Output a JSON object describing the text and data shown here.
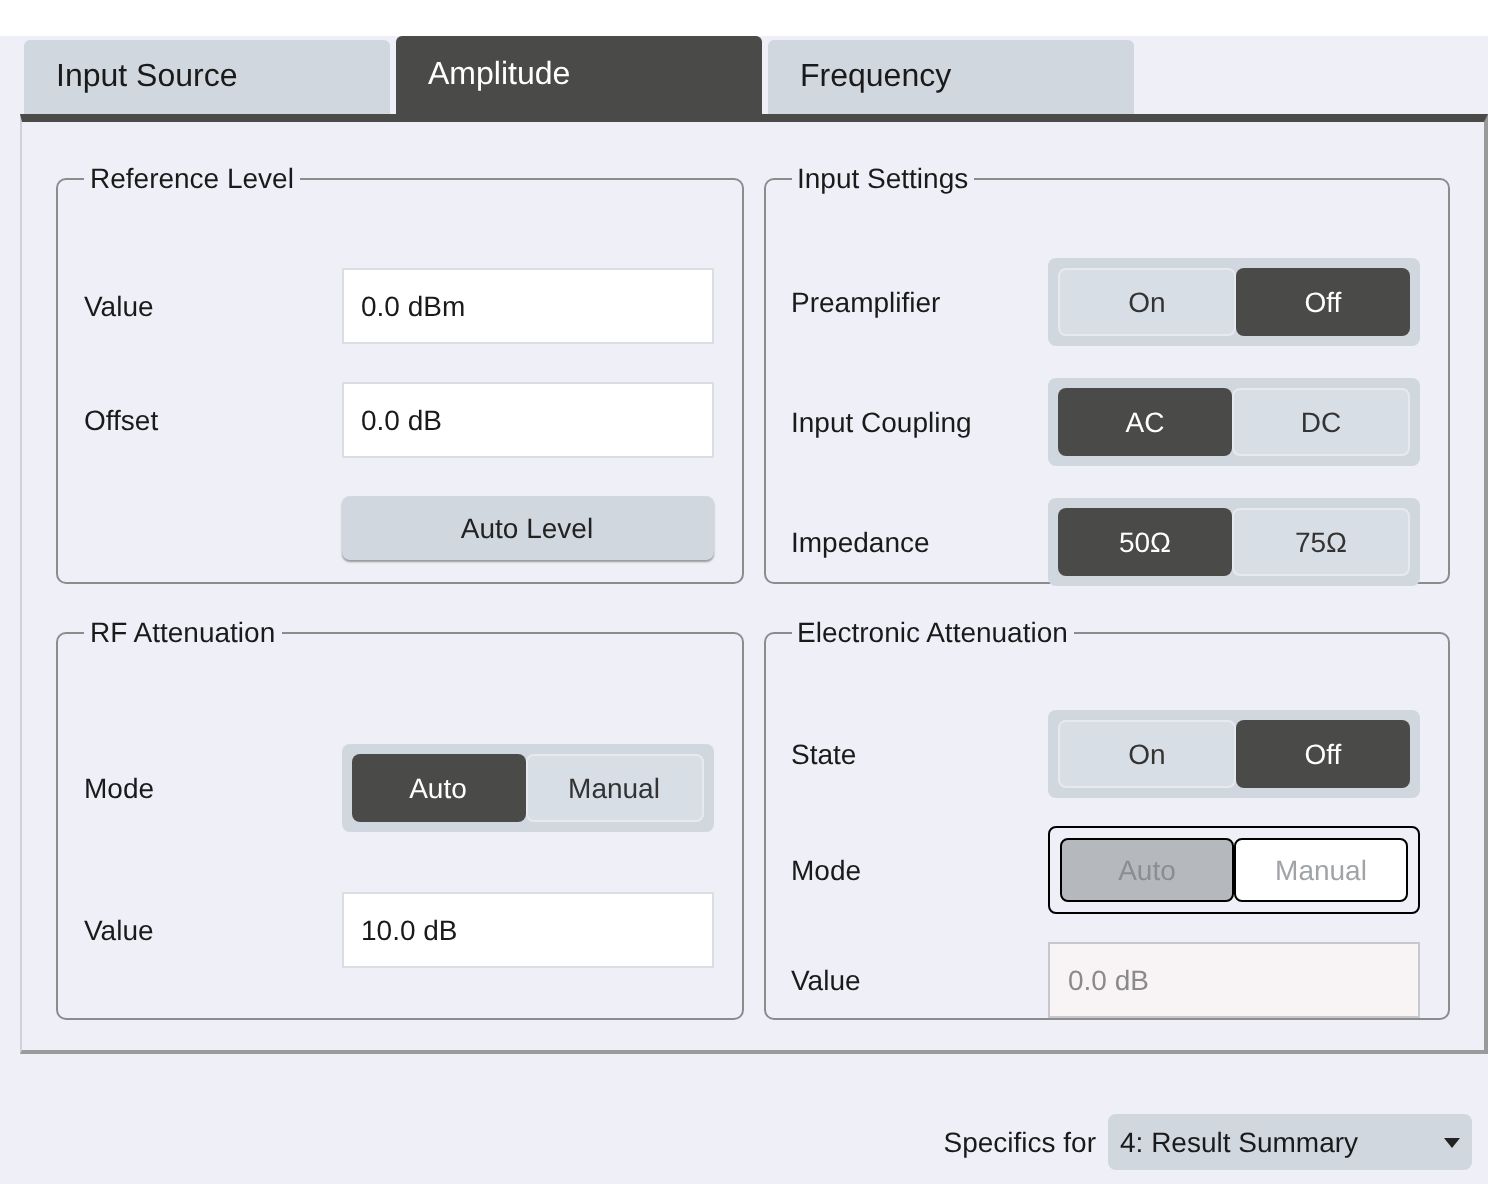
{
  "tabs": [
    {
      "label": "Input Source",
      "selected": false
    },
    {
      "label": "Amplitude",
      "selected": true
    },
    {
      "label": "Frequency",
      "selected": false
    }
  ],
  "groups": [
    {
      "title": "Reference Level",
      "rows": [
        {
          "kind": "field",
          "label": "Value",
          "value": "0.0 dBm",
          "disabled": false
        },
        {
          "kind": "field",
          "label": "Offset",
          "value": "0.0 dB",
          "disabled": false
        },
        {
          "kind": "button",
          "label": "Auto Level"
        }
      ]
    },
    {
      "title": "Input Settings",
      "rows": [
        {
          "kind": "toggle",
          "label": "Preamplifier",
          "disabled": false,
          "options": [
            {
              "label": "On",
              "selected": false
            },
            {
              "label": "Off",
              "selected": true
            }
          ]
        },
        {
          "kind": "toggle",
          "label": "Input Coupling",
          "disabled": false,
          "options": [
            {
              "label": "AC",
              "selected": true
            },
            {
              "label": "DC",
              "selected": false
            }
          ]
        },
        {
          "kind": "toggle",
          "label": "Impedance",
          "disabled": false,
          "options": [
            {
              "label": "50Ω",
              "selected": true
            },
            {
              "label": "75Ω",
              "selected": false
            }
          ]
        }
      ]
    },
    {
      "title": "RF Attenuation",
      "rows": [
        {
          "kind": "toggle",
          "label": "Mode",
          "disabled": false,
          "options": [
            {
              "label": "Auto",
              "selected": true
            },
            {
              "label": "Manual",
              "selected": false
            }
          ]
        },
        {
          "kind": "field",
          "label": "Value",
          "value": "10.0 dB",
          "disabled": false
        }
      ]
    },
    {
      "title": "Electronic Attenuation",
      "rows": [
        {
          "kind": "toggle",
          "label": "State",
          "disabled": false,
          "options": [
            {
              "label": "On",
              "selected": false
            },
            {
              "label": "Off",
              "selected": true
            }
          ]
        },
        {
          "kind": "toggle",
          "label": "Mode",
          "disabled": true,
          "options": [
            {
              "label": "Auto",
              "selected": true
            },
            {
              "label": "Manual",
              "selected": false
            }
          ]
        },
        {
          "kind": "field",
          "label": "Value",
          "value": "0.0 dB",
          "disabled": true
        }
      ]
    }
  ],
  "specifics": {
    "label": "Specifics for",
    "value": "4: Result Summary"
  }
}
